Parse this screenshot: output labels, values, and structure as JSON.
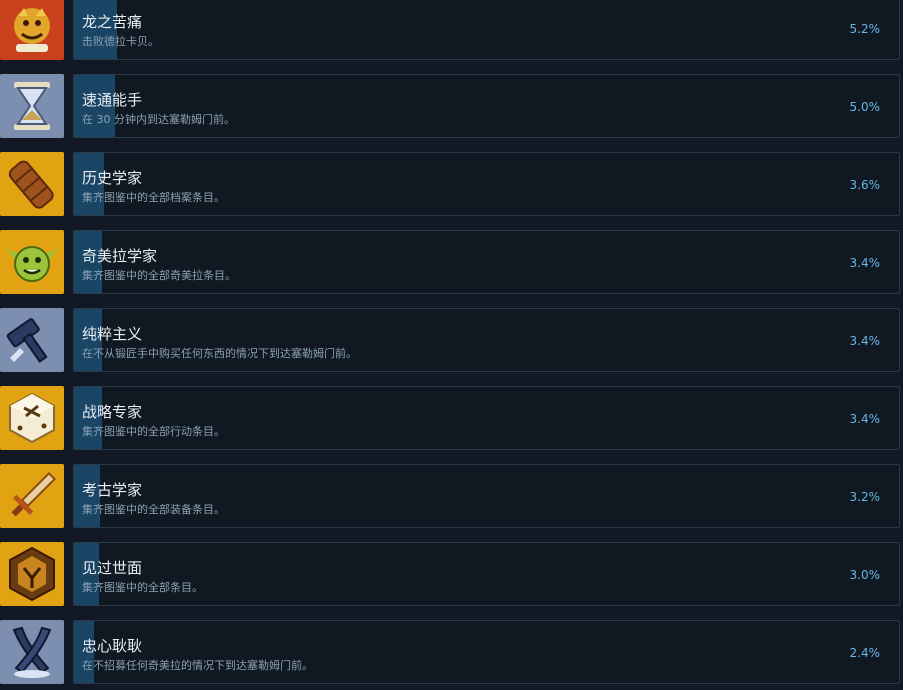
{
  "achievements": [
    {
      "title": "龙之苦痛",
      "description": "击败德拉卡贝。",
      "percent": "5.2%",
      "percent_value": 5.2,
      "icon": "dragon-icon",
      "icon_bg": "#c8401c"
    },
    {
      "title": "速通能手",
      "description": "在 30 分钟内到达塞勒姆门前。",
      "percent": "5.0%",
      "percent_value": 5.0,
      "icon": "hourglass-icon",
      "icon_bg": "#7d8fb0"
    },
    {
      "title": "历史学家",
      "description": "集齐图鉴中的全部档案条目。",
      "percent": "3.6%",
      "percent_value": 3.6,
      "icon": "scroll-icon",
      "icon_bg": "#e2a312"
    },
    {
      "title": "奇美拉学家",
      "description": "集齐图鉴中的全部奇美拉条目。",
      "percent": "3.4%",
      "percent_value": 3.4,
      "icon": "goblin-face-icon",
      "icon_bg": "#e2a312"
    },
    {
      "title": "纯粹主义",
      "description": "在不从锻匠手中购买任何东西的情况下到达塞勒姆门前。",
      "percent": "3.4%",
      "percent_value": 3.4,
      "icon": "hammer-icon",
      "icon_bg": "#7d8fb0"
    },
    {
      "title": "战略专家",
      "description": "集齐图鉴中的全部行动条目。",
      "percent": "3.4%",
      "percent_value": 3.4,
      "icon": "dice-icon",
      "icon_bg": "#e2a312"
    },
    {
      "title": "考古学家",
      "description": "集齐图鉴中的全部装备条目。",
      "percent": "3.2%",
      "percent_value": 3.2,
      "icon": "sword-icon",
      "icon_bg": "#e2a312"
    },
    {
      "title": "见过世面",
      "description": "集齐图鉴中的全部条目。",
      "percent": "3.0%",
      "percent_value": 3.0,
      "icon": "emblem-icon",
      "icon_bg": "#e2a312"
    },
    {
      "title": "忠心耿耿",
      "description": "在不招募任何奇美拉的情况下到达塞勒姆门前。",
      "percent": "2.4%",
      "percent_value": 2.4,
      "icon": "crossed-horns-icon",
      "icon_bg": "#7d8fb0"
    }
  ]
}
